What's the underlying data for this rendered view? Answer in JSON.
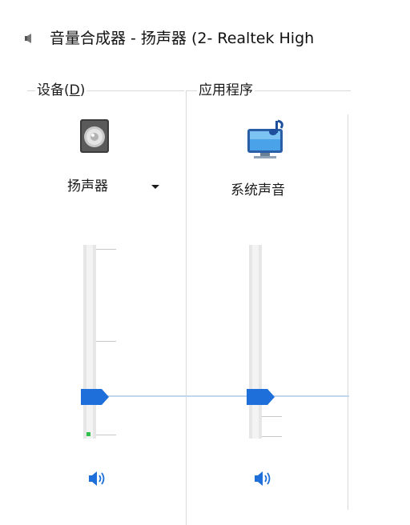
{
  "window": {
    "title": "音量合成器 - 扬声器 (2- Realtek High"
  },
  "device_group": {
    "label_prefix": "设备(",
    "label_accel": "D",
    "label_suffix": ")",
    "device_name": "扬声器",
    "device_icon": "speaker-device-icon",
    "dropdown_icon": "chevron-down-icon",
    "mute_icon": "speaker-volume-icon",
    "volume_level": 0.17,
    "peak_level": 0.03
  },
  "apps_group": {
    "label": "应用程序",
    "apps": [
      {
        "name": "系统声音",
        "icon": "system-sounds-icon",
        "mute_icon": "speaker-volume-icon",
        "volume_level": 0.17
      }
    ]
  },
  "colors": {
    "accent": "#1e6fd9",
    "meter": "#2fbf4a",
    "divider": "#d9d9d9"
  }
}
